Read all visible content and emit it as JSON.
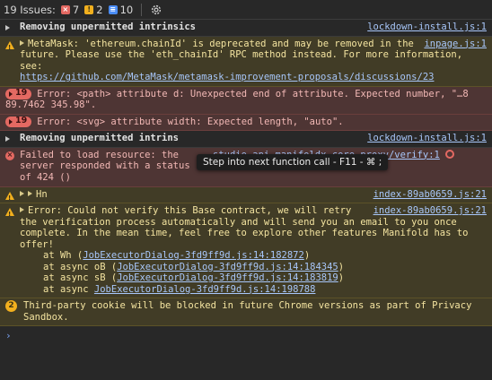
{
  "toolbar": {
    "issues_label": "19 Issues:",
    "error_count": "7",
    "warning_count": "2",
    "info_count": "10"
  },
  "messages": [
    {
      "type": "group",
      "text": "Removing unpermitted intrinsics",
      "source": "lockdown-install.js:1"
    },
    {
      "type": "warn",
      "text": "MetaMask: 'ethereum.chainId' is deprecated and may be removed in the future. Please use the 'eth_chainId' RPC method instead. For more information, see:",
      "link": "https://github.com/MetaMask/metamask-improvement-proposals/discussions/23",
      "source": "inpage.js:1"
    },
    {
      "type": "err",
      "repeat": "19",
      "text": "Error: <path> attribute d: Unexpected end of attribute. Expected number, \"…8 89.7462 345.98\"."
    },
    {
      "type": "err",
      "repeat": "19",
      "text": "Error: <svg> attribute width: Expected length, \"auto\"."
    },
    {
      "type": "group",
      "text": "Removing unpermitted intrins",
      "source": "lockdown-install.js:1"
    },
    {
      "type": "err",
      "text": "Failed to load resource: the server responded with a status of 424 ()",
      "source": "studio.api.manifoldx…core-proxy/verify:1"
    },
    {
      "type": "warn",
      "text": "Hn",
      "source": "index-89ab0659.js:21"
    },
    {
      "type": "warn",
      "text": "Error: Could not verify this Base contract, we will retry the verification process automatically and will send you an email to you once complete. In the mean time, feel free to explore other features Manifold has to offer!",
      "source": "index-89ab0659.js:21",
      "stack": [
        {
          "prefix": "at Wh (",
          "link": "JobExecutorDialog-3fd9ff9d.js:14:182872",
          "suffix": ")"
        },
        {
          "prefix": "at async oB (",
          "link": "JobExecutorDialog-3fd9ff9d.js:14:184345",
          "suffix": ")"
        },
        {
          "prefix": "at async sB (",
          "link": "JobExecutorDialog-3fd9ff9d.js:14:183819",
          "suffix": ")"
        },
        {
          "prefix": "at async ",
          "link": "JobExecutorDialog-3fd9ff9d.js:14:198788",
          "suffix": ""
        }
      ]
    },
    {
      "type": "warn",
      "badge": "2",
      "text": "Third-party cookie will be blocked in future Chrome versions as part of Privacy Sandbox."
    }
  ],
  "tooltip": "Step into next function call - F11 - ⌘ ;",
  "prompt_symbol": "›",
  "colors": {
    "error": "#e46962",
    "warning": "#f2b01e",
    "info": "#4b8df8",
    "link": "#a8c7fa"
  }
}
